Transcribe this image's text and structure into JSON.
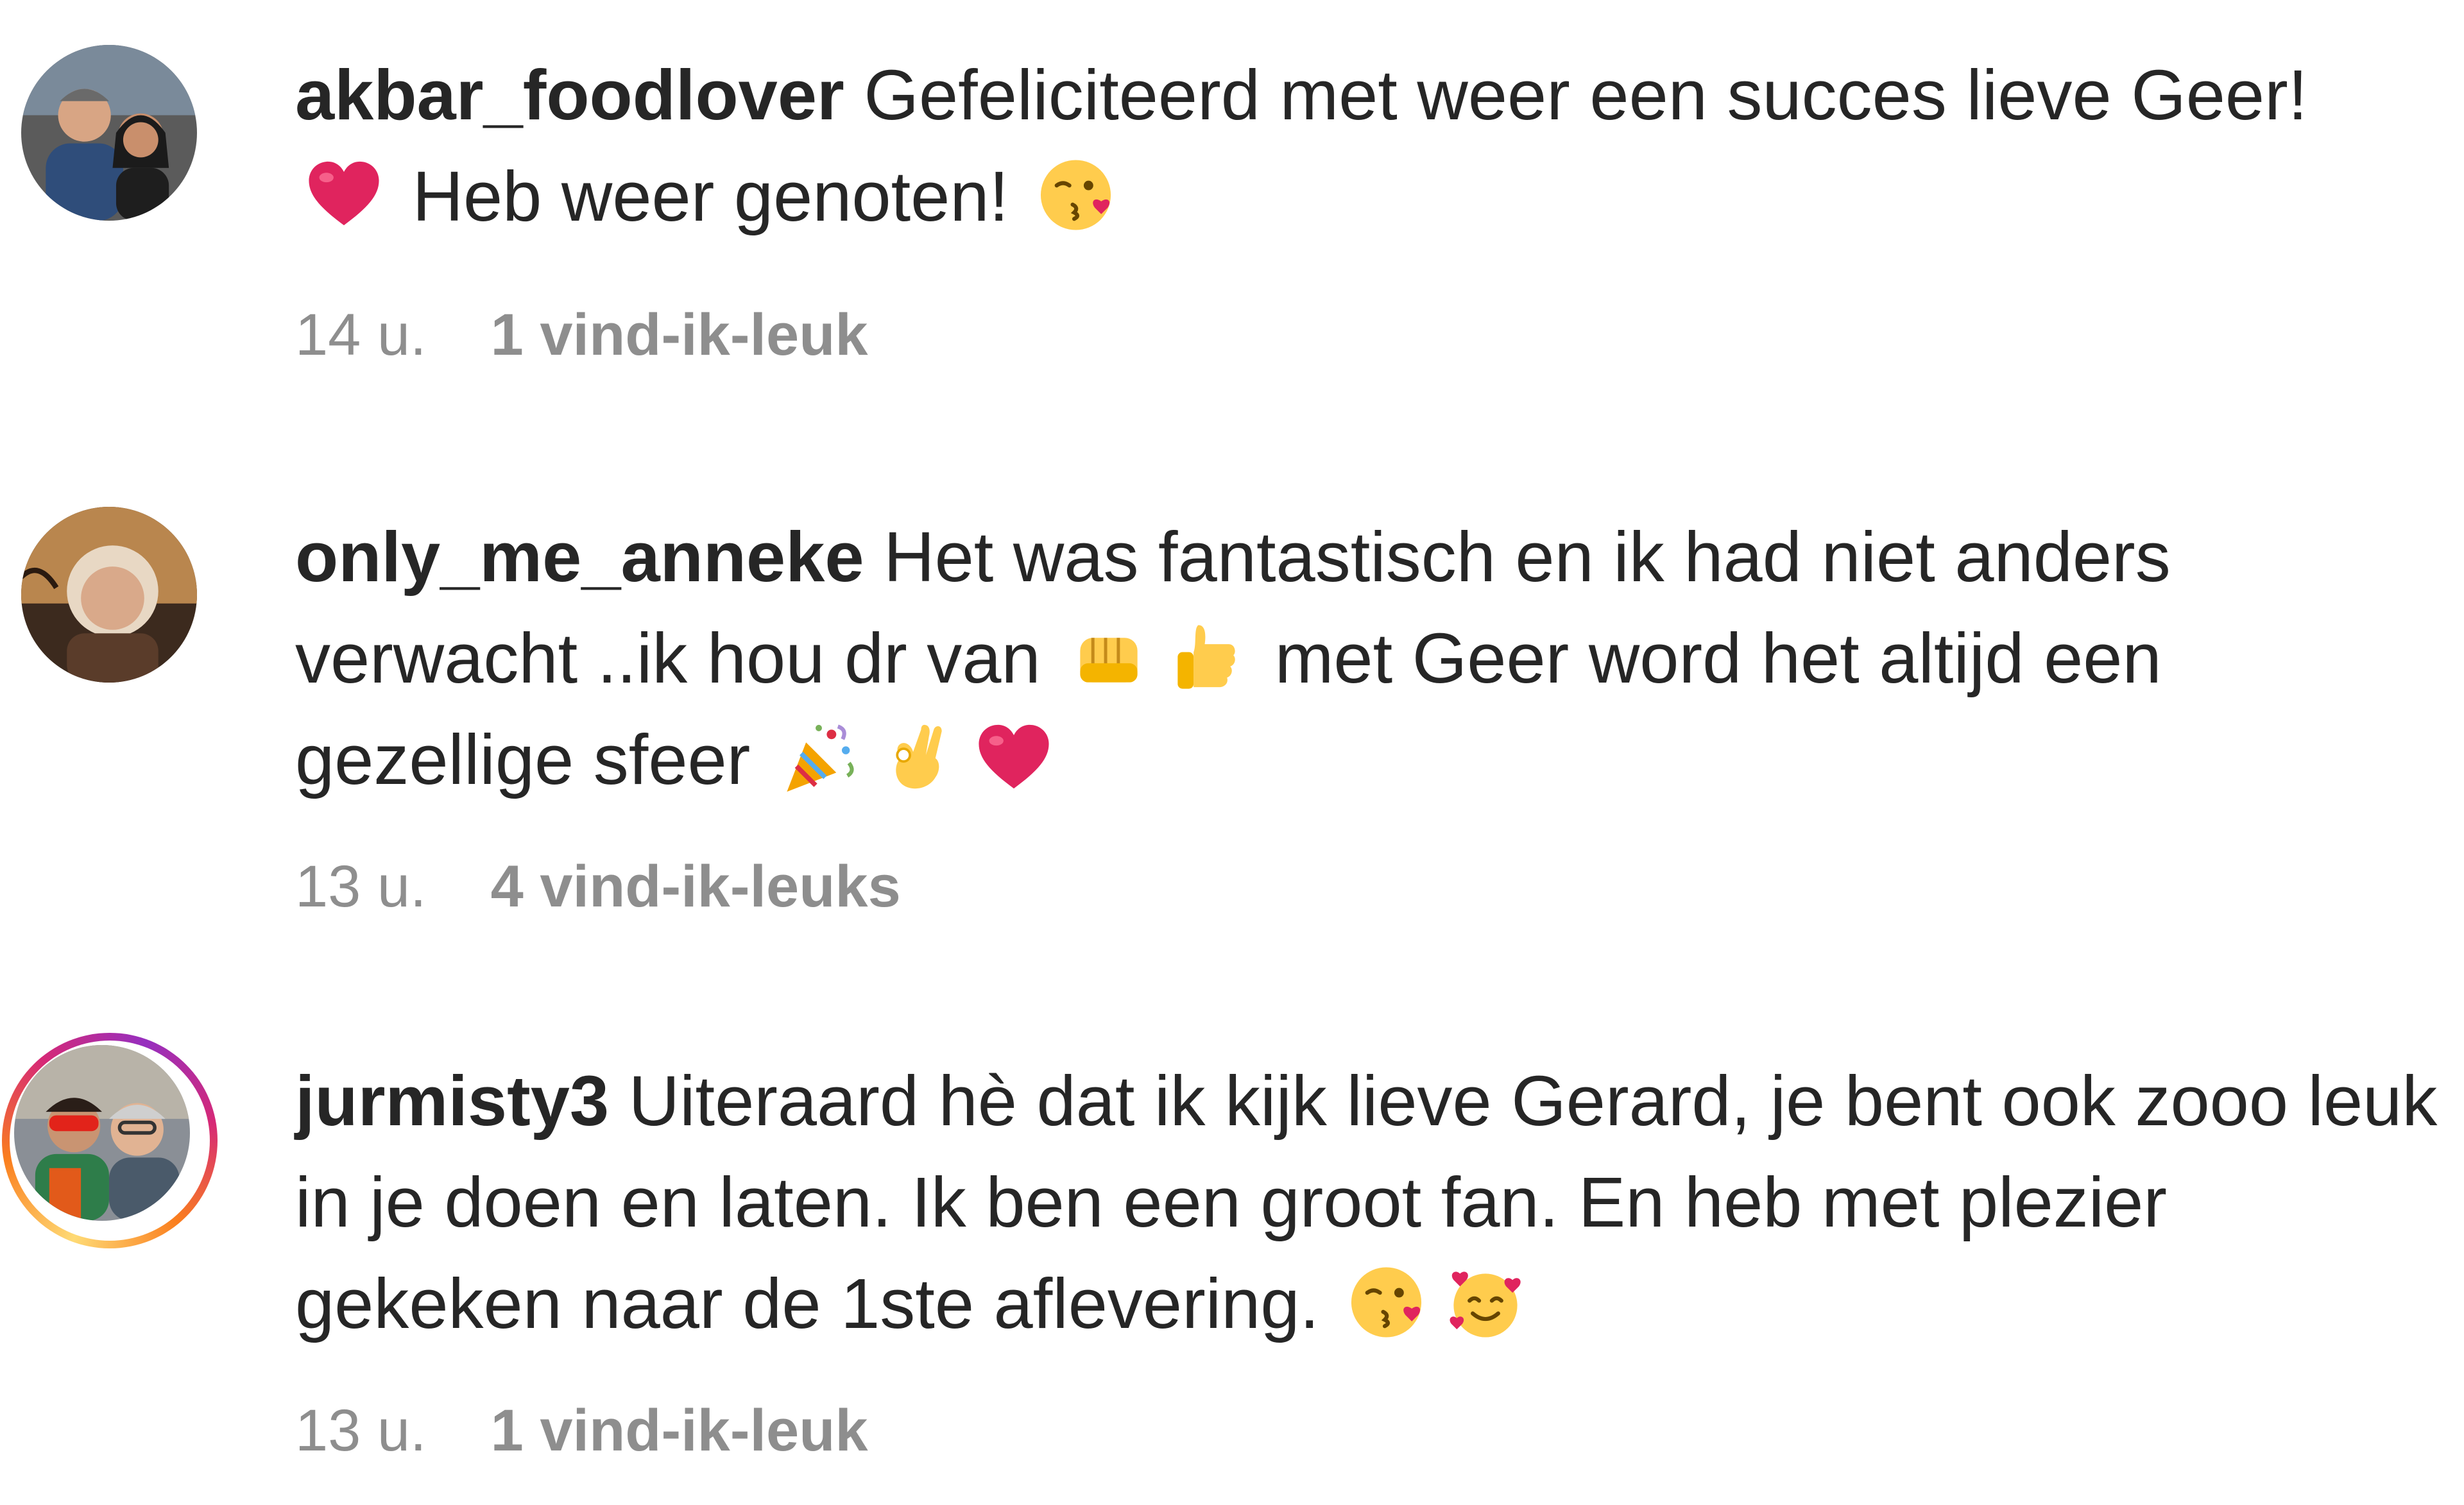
{
  "comments": [
    {
      "username": "akbar_foodlover",
      "text_parts": [
        "Gefeliciteerd met weer een succes lieve Geer!",
        "Heb weer genoten!"
      ],
      "emojis": [
        "red-heart-emoji",
        "face-blowing-kiss-emoji"
      ],
      "time": "14 u.",
      "likes": "1 vind-ik-leuk",
      "has_story_ring": false
    },
    {
      "username": "only_me_anneke",
      "text_parts": [
        "Het was fantastisch en ik had niet anders verwacht ..ik hou dr van",
        "met Geer word het altijd een gezellige sfeer"
      ],
      "emojis": [
        "oncoming-fist-emoji",
        "thumbs-up-emoji",
        "party-popper-emoji",
        "ok-hand-emoji",
        "red-heart-emoji"
      ],
      "time": "13 u.",
      "likes": "4 vind-ik-leuks",
      "has_story_ring": false
    },
    {
      "username": "jurmisty3",
      "text_parts": [
        "Uiteraard hè dat ik kijk lieve Gerard, je bent ook zooo leuk in je doen en laten. Ik ben een groot fan. En heb met plezier gekeken naar de 1ste aflevering."
      ],
      "emojis": [
        "face-blowing-kiss-emoji",
        "smiling-face-with-hearts-emoji"
      ],
      "time": "13 u.",
      "likes": "1 vind-ik-leuk",
      "has_story_ring": true
    }
  ],
  "colors": {
    "text": "#262626",
    "meta": "#8e8e8e",
    "heart": "#e0245e",
    "emoji_yellow": "#ffcc4d"
  }
}
